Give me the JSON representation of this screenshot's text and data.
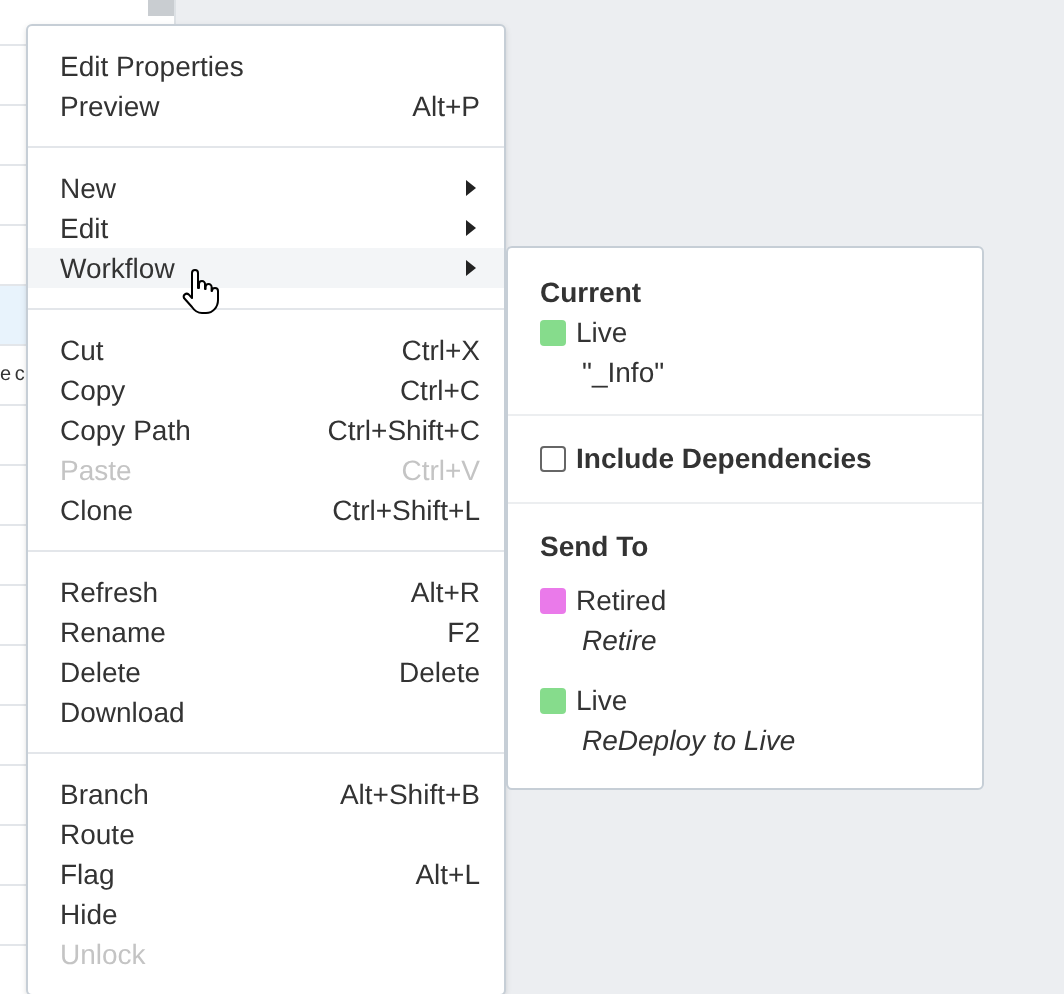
{
  "background": {
    "rows": [
      {
        "text": "",
        "selected": false
      },
      {
        "text": "",
        "selected": false
      },
      {
        "text": "",
        "selected": false
      },
      {
        "text": "",
        "selected": false
      },
      {
        "text": "",
        "selected": true
      },
      {
        "text": "e c",
        "selected": false
      },
      {
        "text": "",
        "selected": false
      },
      {
        "text": "",
        "selected": false
      },
      {
        "text": "",
        "selected": false
      },
      {
        "text": "",
        "selected": false
      },
      {
        "text": "",
        "selected": false
      },
      {
        "text": "",
        "selected": false
      },
      {
        "text": "",
        "selected": false
      },
      {
        "text": "",
        "selected": false
      },
      {
        "text": "",
        "selected": false
      },
      {
        "text": "",
        "selected": false
      }
    ]
  },
  "context_menu": {
    "sections": [
      [
        {
          "label": "Edit Properties",
          "disabled": false,
          "hovered": false,
          "submenu": false
        },
        {
          "label": "Preview",
          "shortcut": "Alt+P",
          "disabled": false,
          "hovered": false,
          "submenu": false
        }
      ],
      [
        {
          "label": "New",
          "disabled": false,
          "hovered": false,
          "submenu": true
        },
        {
          "label": "Edit",
          "disabled": false,
          "hovered": false,
          "submenu": true
        },
        {
          "label": "Workflow",
          "disabled": false,
          "hovered": true,
          "submenu": true
        }
      ],
      [
        {
          "label": "Cut",
          "shortcut": "Ctrl+X",
          "disabled": false,
          "hovered": false,
          "submenu": false
        },
        {
          "label": "Copy",
          "shortcut": "Ctrl+C",
          "disabled": false,
          "hovered": false,
          "submenu": false
        },
        {
          "label": "Copy Path",
          "shortcut": "Ctrl+Shift+C",
          "disabled": false,
          "hovered": false,
          "submenu": false
        },
        {
          "label": "Paste",
          "shortcut": "Ctrl+V",
          "disabled": true,
          "hovered": false,
          "submenu": false
        },
        {
          "label": "Clone",
          "shortcut": "Ctrl+Shift+L",
          "disabled": false,
          "hovered": false,
          "submenu": false
        }
      ],
      [
        {
          "label": "Refresh",
          "shortcut": "Alt+R",
          "disabled": false,
          "hovered": false,
          "submenu": false
        },
        {
          "label": "Rename",
          "shortcut": "F2",
          "disabled": false,
          "hovered": false,
          "submenu": false
        },
        {
          "label": "Delete",
          "shortcut": "Delete",
          "disabled": false,
          "hovered": false,
          "submenu": false
        },
        {
          "label": "Download",
          "disabled": false,
          "hovered": false,
          "submenu": false
        }
      ],
      [
        {
          "label": "Branch",
          "shortcut": "Alt+Shift+B",
          "disabled": false,
          "hovered": false,
          "submenu": false
        },
        {
          "label": "Route",
          "disabled": false,
          "hovered": false,
          "submenu": false
        },
        {
          "label": "Flag",
          "shortcut": "Alt+L",
          "disabled": false,
          "hovered": false,
          "submenu": false
        },
        {
          "label": "Hide",
          "disabled": false,
          "hovered": false,
          "submenu": false
        },
        {
          "label": "Unlock",
          "disabled": true,
          "hovered": false,
          "submenu": false
        }
      ]
    ]
  },
  "workflow_panel": {
    "current": {
      "heading": "Current",
      "state": "Live",
      "color": "#86dc8c",
      "detail": "\"_Info\""
    },
    "include_dependencies": {
      "label": "Include Dependencies",
      "checked": false
    },
    "send_to": {
      "heading": "Send To",
      "targets": [
        {
          "state": "Retired",
          "color": "#ea7aea",
          "action": "Retire"
        },
        {
          "state": "Live",
          "color": "#86dc8c",
          "action": "ReDeploy to Live"
        }
      ]
    }
  }
}
